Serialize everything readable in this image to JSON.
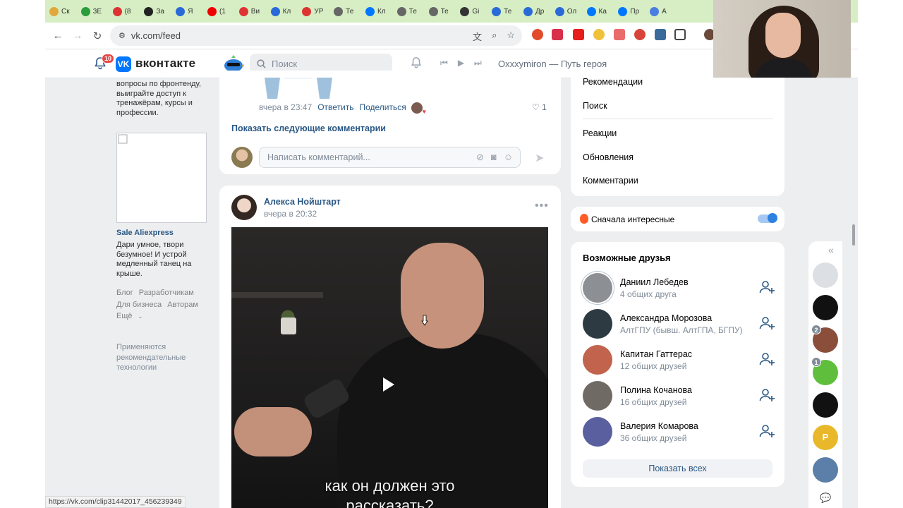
{
  "browser": {
    "tabs": [
      "Ск",
      "3Е",
      "(8",
      "За",
      "Я",
      "(1",
      "Ви",
      "Кл",
      "УР",
      "Те",
      "Кл",
      "Те",
      "Те",
      "Gi",
      "Те",
      "Др",
      "Ол",
      "Ка",
      "Пр",
      "А"
    ],
    "tab_colors": [
      "#e0a83a",
      "#2a9d3a",
      "#d33",
      "#222",
      "#2a6ad8",
      "#e00",
      "#d33",
      "#2a6ad8",
      "#d33",
      "#666",
      "#0077ff",
      "#666",
      "#666",
      "#333",
      "#2a6ad8",
      "#2a6ad8",
      "#2a6ad8",
      "#0077ff",
      "#0077ff",
      "#4a7de0"
    ],
    "url": "vk.com/feed",
    "status_url": "https://vk.com/clip31442017_456239349"
  },
  "vk_header": {
    "notif_count": "10",
    "logo_letter": "VK",
    "brand": "вконтакте",
    "search_placeholder": "Поиск",
    "now_playing": "Oxxxymiron — Путь героя"
  },
  "left_column": {
    "ad1_text": "вопросы по фронтенду, выиграйте доступ к тренажёрам, курсы и профессии.",
    "ad2_title": "Sale Aliexpress",
    "ad2_text": "Дари умное, твори безумное! И устрой медленный танец на крыше.",
    "links": [
      "Блог",
      "Разработчикам",
      "Для бизнеса",
      "Авторам",
      "Ещё"
    ],
    "tech_note": "Применяются рекомендательные технологии"
  },
  "post1": {
    "time": "вчера в 23:47",
    "reply": "Ответить",
    "share": "Поделиться",
    "likes": "1",
    "show_more": "Показать следующие комментарии",
    "comment_placeholder": "Написать комментарий..."
  },
  "post2": {
    "author": "Алекса Нойштарт",
    "time": "вчера в 20:32",
    "subtitle1": "как он должен это",
    "subtitle2": "рассказать?"
  },
  "right_menu": {
    "items": [
      "Рекомендации",
      "Поиск",
      "Реакции",
      "Обновления",
      "Комментарии"
    ]
  },
  "sort": {
    "label": "Сначала интересные",
    "enabled": true
  },
  "friends": {
    "title": "Возможные друзья",
    "items": [
      {
        "name": "Даниил Лебедев",
        "sub": "4 общих друга",
        "color": "#8c8f94"
      },
      {
        "name": "Александра Морозова",
        "sub": "АлтГПУ (бывш. АлтГПА, БГПУ)",
        "color": "#2e3a42"
      },
      {
        "name": "Капитан Гаттерас",
        "sub": "12 общих друзей",
        "color": "#c2634d"
      },
      {
        "name": "Полина Кочанова",
        "sub": "16 общих друзей",
        "color": "#6f6a64"
      },
      {
        "name": "Валерия Комарова",
        "sub": "36 общих друзей",
        "color": "#5a5fa0"
      }
    ],
    "show_all": "Показать всех"
  },
  "chat_rail": {
    "avatars": [
      {
        "color": "#dcdfe3",
        "badge": ""
      },
      {
        "color": "#111111",
        "badge": ""
      },
      {
        "color": "#8a4e3a",
        "badge": "2"
      },
      {
        "color": "#5fbf3c",
        "badge": "1"
      },
      {
        "color": "#111111",
        "badge": ""
      },
      {
        "color": "#e8b82a",
        "badge": "",
        "letter": "P"
      },
      {
        "color": "#5b7fa8",
        "badge": ""
      }
    ]
  }
}
